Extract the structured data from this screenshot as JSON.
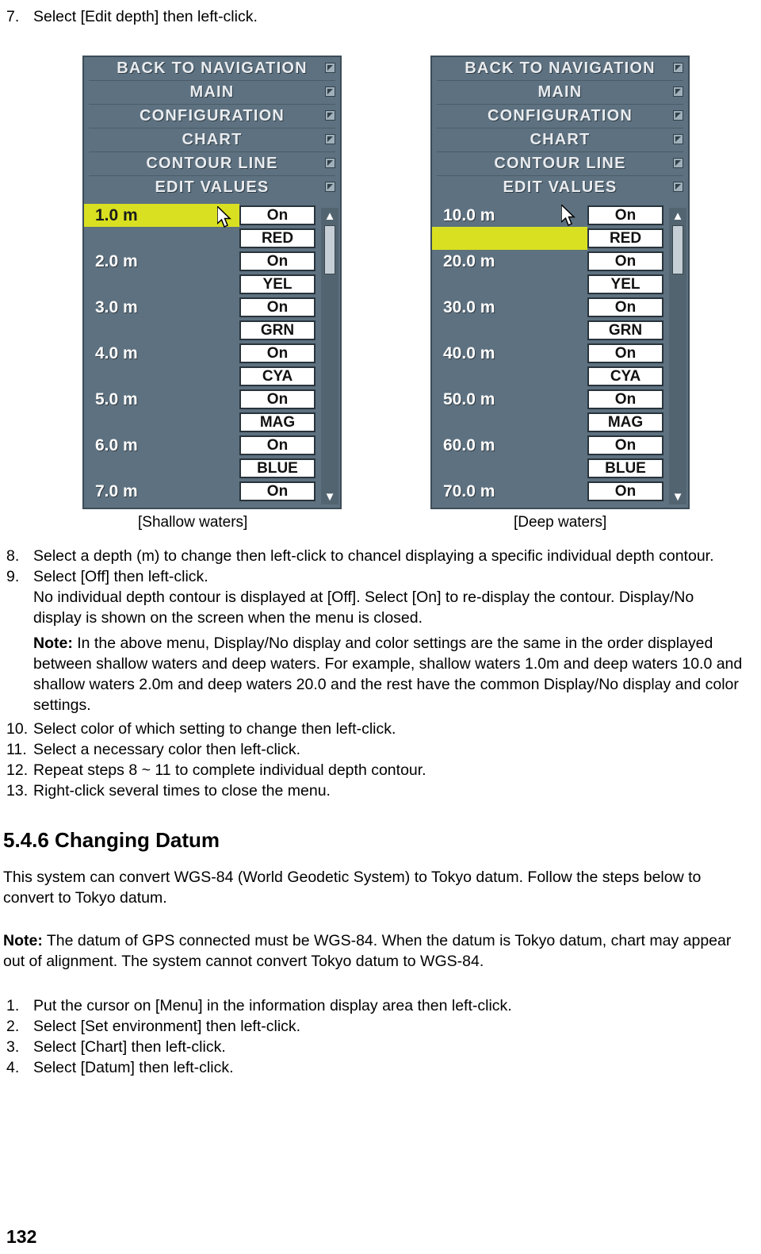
{
  "steps": {
    "s7": {
      "num": "7.",
      "text": "Select [Edit depth] then left-click."
    },
    "s8": {
      "num": "8.",
      "text": "Select a depth (m) to change then left-click to chancel displaying a specific individual depth contour."
    },
    "s9": {
      "num": "9.",
      "text": "Select [Off] then left-click."
    },
    "s9_note1": "No individual depth contour is displayed at [Off]. Select [On] to re-display the contour. Display/No display is shown on the screen when the menu is closed.",
    "s9_note2_label": "Note:",
    "s9_note2": " In the above menu, Display/No display and color settings are the same in the order displayed between shallow waters and deep waters. For example, shallow waters 1.0m and deep waters 10.0 and shallow waters 2.0m and deep waters 20.0 and the rest have the common Display/No display and color settings.",
    "s10": {
      "num": "10.",
      "text": "Select color of which setting to change then left-click."
    },
    "s11": {
      "num": "11.",
      "text": "Select a necessary color then left-click."
    },
    "s12": {
      "num": "12.",
      "text": "Repeat steps 8 ~ 11 to complete individual depth contour."
    },
    "s13": {
      "num": "13.",
      "text": "Right-click several times to close the menu."
    }
  },
  "figures": {
    "shallow": {
      "caption": "[Shallow waters]",
      "headers": [
        "BACK TO NAVIGATION",
        "MAIN",
        "CONFIGURATION",
        "CHART",
        "CONTOUR LINE",
        "EDIT VALUES"
      ],
      "rows": [
        {
          "depth": "1.0 m",
          "highlight": true,
          "option": "On"
        },
        {
          "depth": "",
          "option": "RED"
        },
        {
          "depth": "2.0 m",
          "option": "On"
        },
        {
          "depth": "",
          "option": "YEL"
        },
        {
          "depth": "3.0 m",
          "option": "On"
        },
        {
          "depth": "",
          "option": "GRN"
        },
        {
          "depth": "4.0 m",
          "option": "On"
        },
        {
          "depth": "",
          "option": "CYA"
        },
        {
          "depth": "5.0 m",
          "option": "On"
        },
        {
          "depth": "",
          "option": "MAG"
        },
        {
          "depth": "6.0 m",
          "option": "On"
        },
        {
          "depth": "",
          "option": "BLUE"
        },
        {
          "depth": "7.0 m",
          "option": "On"
        }
      ]
    },
    "deep": {
      "caption": "[Deep waters]",
      "headers": [
        "BACK TO NAVIGATION",
        "MAIN",
        "CONFIGURATION",
        "CHART",
        "CONTOUR LINE",
        "EDIT VALUES"
      ],
      "rows": [
        {
          "depth": "10.0 m",
          "option": "On"
        },
        {
          "depth": "",
          "highlight": true,
          "option": "RED"
        },
        {
          "depth": "20.0 m",
          "option": "On"
        },
        {
          "depth": "",
          "option": "YEL"
        },
        {
          "depth": "30.0 m",
          "option": "On"
        },
        {
          "depth": "",
          "option": "GRN"
        },
        {
          "depth": "40.0 m",
          "option": "On"
        },
        {
          "depth": "",
          "option": "CYA"
        },
        {
          "depth": "50.0 m",
          "option": "On"
        },
        {
          "depth": "",
          "option": "MAG"
        },
        {
          "depth": "60.0 m",
          "option": "On"
        },
        {
          "depth": "",
          "option": "BLUE"
        },
        {
          "depth": "70.0 m",
          "option": "On"
        }
      ]
    }
  },
  "section": {
    "heading": "5.4.6 Changing Datum",
    "para1": "This system can convert WGS-84 (World Geodetic System) to Tokyo datum. Follow the steps below to convert to Tokyo datum.",
    "note_label": "Note:",
    "note_text": " The datum of GPS connected must be WGS-84. When the datum is Tokyo datum, chart may appear out of alignment. The system cannot convert Tokyo datum to WGS-84.",
    "steps": [
      {
        "num": "1.",
        "text": "Put the cursor on [Menu] in the information display area then left-click."
      },
      {
        "num": "2.",
        "text": "Select [Set environment] then left-click."
      },
      {
        "num": "3.",
        "text": "Select [Chart] then left-click."
      },
      {
        "num": "4.",
        "text": "Select [Datum] then left-click."
      }
    ]
  },
  "page_number": "132"
}
